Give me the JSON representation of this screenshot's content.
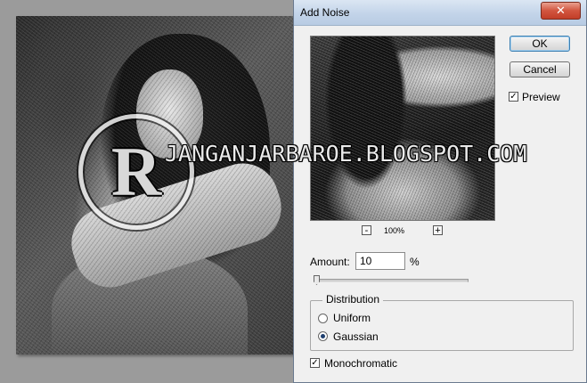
{
  "canvas": {
    "watermark_logo": "R",
    "watermark_text": "JANGANJARBAROE.BLOGSPOT.COM"
  },
  "dialog": {
    "title": "Add Noise",
    "close_glyph": "✕",
    "ok_label": "OK",
    "cancel_label": "Cancel",
    "preview_label": "Preview",
    "preview_checked": true,
    "zoom_minus": "-",
    "zoom_plus": "+",
    "zoom_level": "100%",
    "amount_label": "Amount:",
    "amount_value": "10",
    "amount_unit": "%",
    "amount_slider_fraction": 0.025,
    "distribution_title": "Distribution",
    "uniform_label": "Uniform",
    "gaussian_label": "Gaussian",
    "selected_distribution": "Gaussian",
    "monochromatic_label": "Monochromatic",
    "monochromatic_checked": true
  },
  "icons": {
    "close": "close-icon",
    "checkbox": "checkmark-icon",
    "radio": "radio-dot-icon"
  }
}
